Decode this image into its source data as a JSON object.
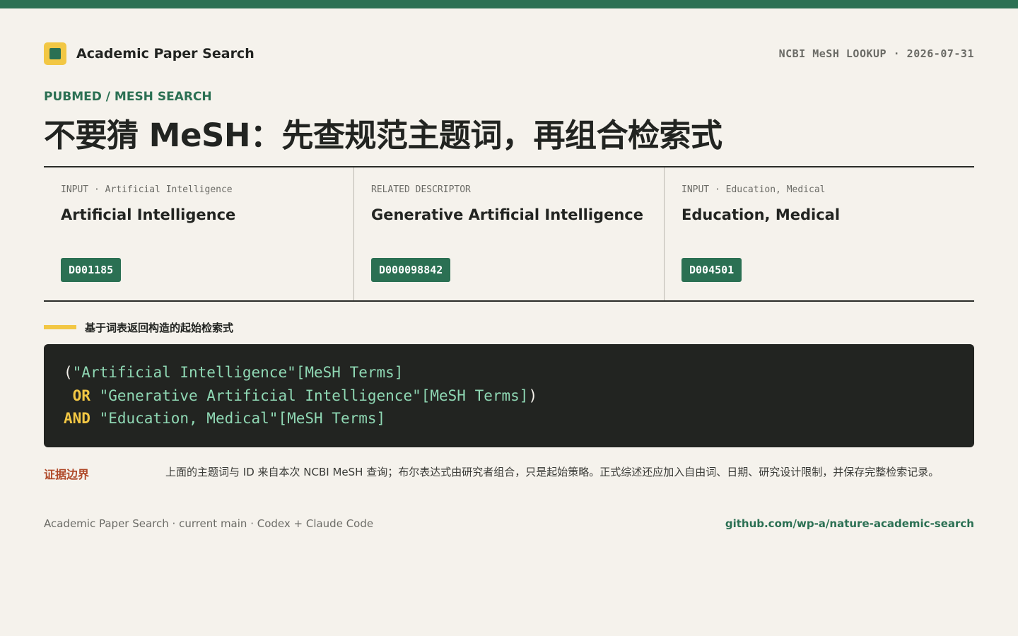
{
  "colors": {
    "accent_green": "#2b7053",
    "accent_yellow": "#f2c744",
    "background": "#f5f2ec",
    "code_background": "#222421",
    "code_string": "#8fd8b4",
    "warning": "#b04a2a"
  },
  "header": {
    "brand": "Academic Paper Search",
    "meta": "NCBI MeSH LOOKUP · 2026-07-31",
    "logo_icon": "square-logo-icon"
  },
  "hero": {
    "eyebrow": "PUBMED / MESH SEARCH",
    "title": "不要猜 MeSH：先查规范主题词，再组合检索式"
  },
  "cards": [
    {
      "label": "INPUT · Artificial Intelligence",
      "term": "Artificial Intelligence",
      "id": "D001185"
    },
    {
      "label": "RELATED DESCRIPTOR",
      "term": "Generative Artificial Intelligence",
      "id": "D000098842"
    },
    {
      "label": "INPUT · Education, Medical",
      "term": "Education, Medical",
      "id": "D004501"
    }
  ],
  "section": {
    "label": "基于词表返回构造的起始检索式"
  },
  "query": {
    "line1": {
      "open": "(",
      "term": "\"Artificial Intelligence\"[MeSH Terms]"
    },
    "line2": {
      "op": " OR ",
      "term": "\"Generative Artificial Intelligence\"[MeSH Terms]",
      "close": ")"
    },
    "line3": {
      "op": "AND ",
      "term": "\"Education, Medical\"[MeSH Terms]"
    }
  },
  "evidence": {
    "label": "证据边界",
    "text": "上面的主题词与 ID 来自本次 NCBI MeSH 查询；布尔表达式由研究者组合，只是起始策略。正式综述还应加入自由词、日期、研究设计限制，并保存完整检索记录。"
  },
  "footer": {
    "left": "Academic Paper Search · current main · Codex + Claude Code",
    "right": "github.com/wp-a/nature-academic-search"
  }
}
